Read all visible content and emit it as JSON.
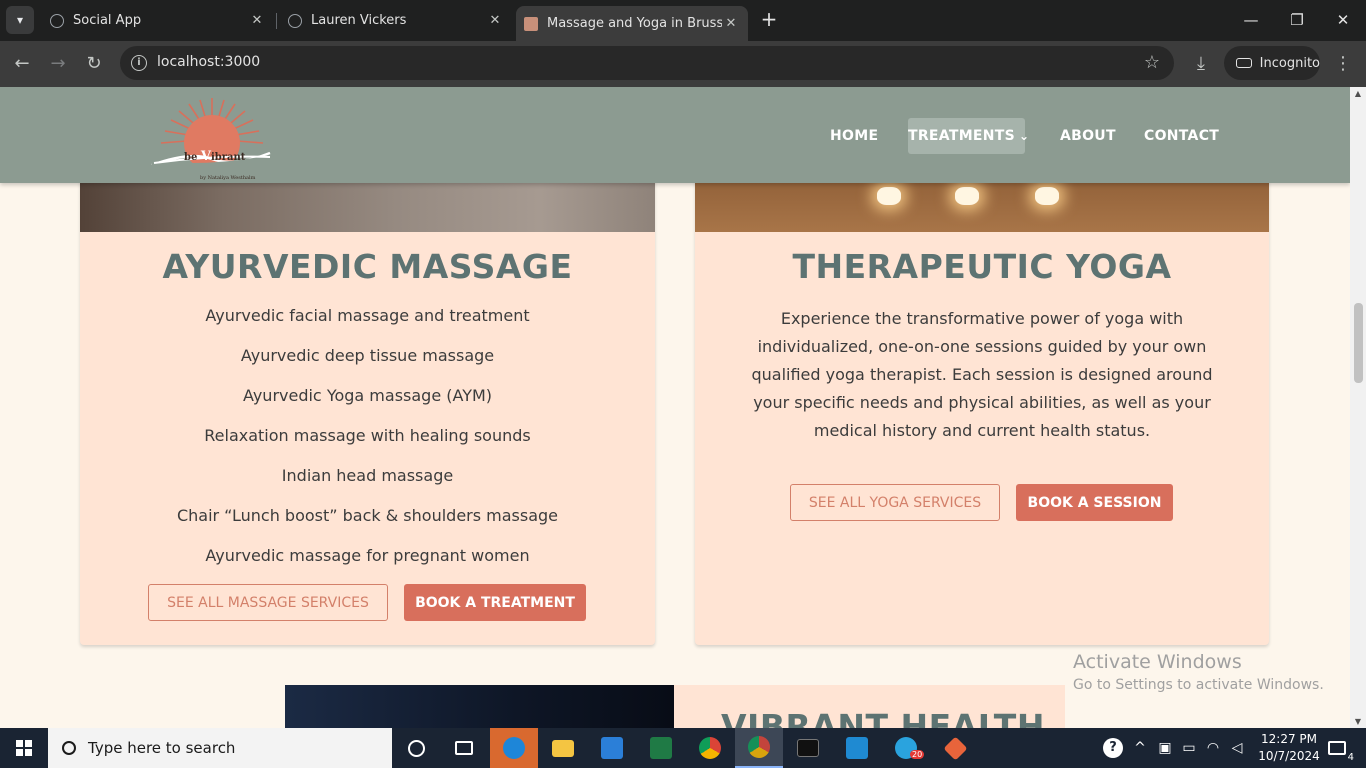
{
  "browser": {
    "tabs": [
      {
        "title": "Social App"
      },
      {
        "title": "Lauren Vickers"
      },
      {
        "title": "Massage and Yoga in Brussels, I"
      }
    ],
    "url": "localhost:3000",
    "incognito_label": "Incognito"
  },
  "site": {
    "logo_text": "be",
    "logo_text_v": "V",
    "logo_text_rest": "ibrant",
    "logo_sub": "by Nataliya Westhalm",
    "nav": [
      "HOME",
      "TREATMENTS",
      "ABOUT",
      "CONTACT"
    ]
  },
  "massage": {
    "title": "AYURVEDIC MASSAGE",
    "services": [
      "Ayurvedic facial massage and treatment",
      "Ayurvedic deep tissue massage",
      "Ayurvedic Yoga massage (AYM)",
      "Relaxation massage with healing sounds",
      "Indian head massage",
      "Chair “Lunch boost” back & shoulders massage",
      "Ayurvedic massage for pregnant women"
    ],
    "btn_all": "SEE ALL MASSAGE SERVICES",
    "btn_book": "BOOK A TREATMENT"
  },
  "yoga": {
    "title": "THERAPEUTIC YOGA",
    "description": "Experience the transformative power of yoga with individualized, one-on-one sessions guided by your own qualified yoga therapist. Each session is designed around your specific needs and physical abilities, as well as your medical history and current health status.",
    "btn_all": "SEE ALL YOGA SERVICES",
    "btn_book": "BOOK A SESSION"
  },
  "next_section": {
    "title": "VIBRANT HEALTH"
  },
  "watermark": {
    "title": "Activate Windows",
    "sub": "Go to Settings to activate Windows."
  },
  "taskbar": {
    "search_placeholder": "Type here to search",
    "time": "12:27 PM",
    "date": "10/7/2024",
    "telegram_badge": "20",
    "notification_count": "4"
  },
  "colors": {
    "header_bg": "#8c9b91",
    "card_bg": "#ffe4d4",
    "title_color": "#5d7372",
    "accent": "#d86f5c"
  }
}
